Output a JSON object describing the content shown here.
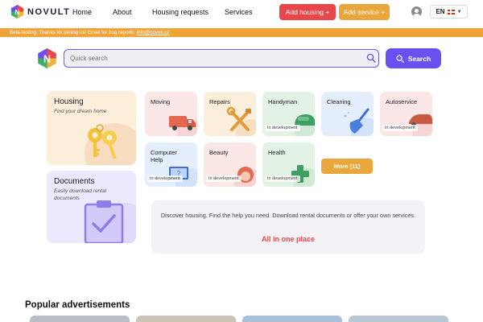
{
  "header": {
    "logo_text": "NOVULT",
    "nav": [
      "Home",
      "About",
      "Housing requests",
      "Services"
    ],
    "add_housing": "Add housing +",
    "add_service": "Add service +",
    "language": "EN"
  },
  "banner": {
    "text": "Beta-testing. Thanks for joining us! Email for bug reports:",
    "email": "info@novult.cz"
  },
  "search": {
    "placeholder": "Quick search",
    "button_label": "Search"
  },
  "housing": {
    "title": "Housing",
    "subtitle": "Find your dream home"
  },
  "documents": {
    "title": "Documents",
    "subtitle": "Easily download rental documents"
  },
  "services": [
    {
      "label": "Moving",
      "badge": ""
    },
    {
      "label": "Repairs",
      "badge": ""
    },
    {
      "label": "Handyman",
      "badge": "In development"
    },
    {
      "label": "Cleaning",
      "badge": ""
    },
    {
      "label": "Autoservice",
      "badge": "In development"
    },
    {
      "label": "Computer Help",
      "badge": "In development"
    },
    {
      "label": "Beauty",
      "badge": "In development"
    },
    {
      "label": "Health",
      "badge": "In development"
    }
  ],
  "more_button": "More (11)",
  "info": {
    "text": "Discover housing. Find the help you need. Download rental documents or offer your own services.",
    "accent": "All in one place"
  },
  "popular": {
    "title": "Popular advertisements"
  },
  "colors": {
    "primary": "#6a50ee",
    "red": "#e8464b",
    "orange": "#e9a63c"
  }
}
